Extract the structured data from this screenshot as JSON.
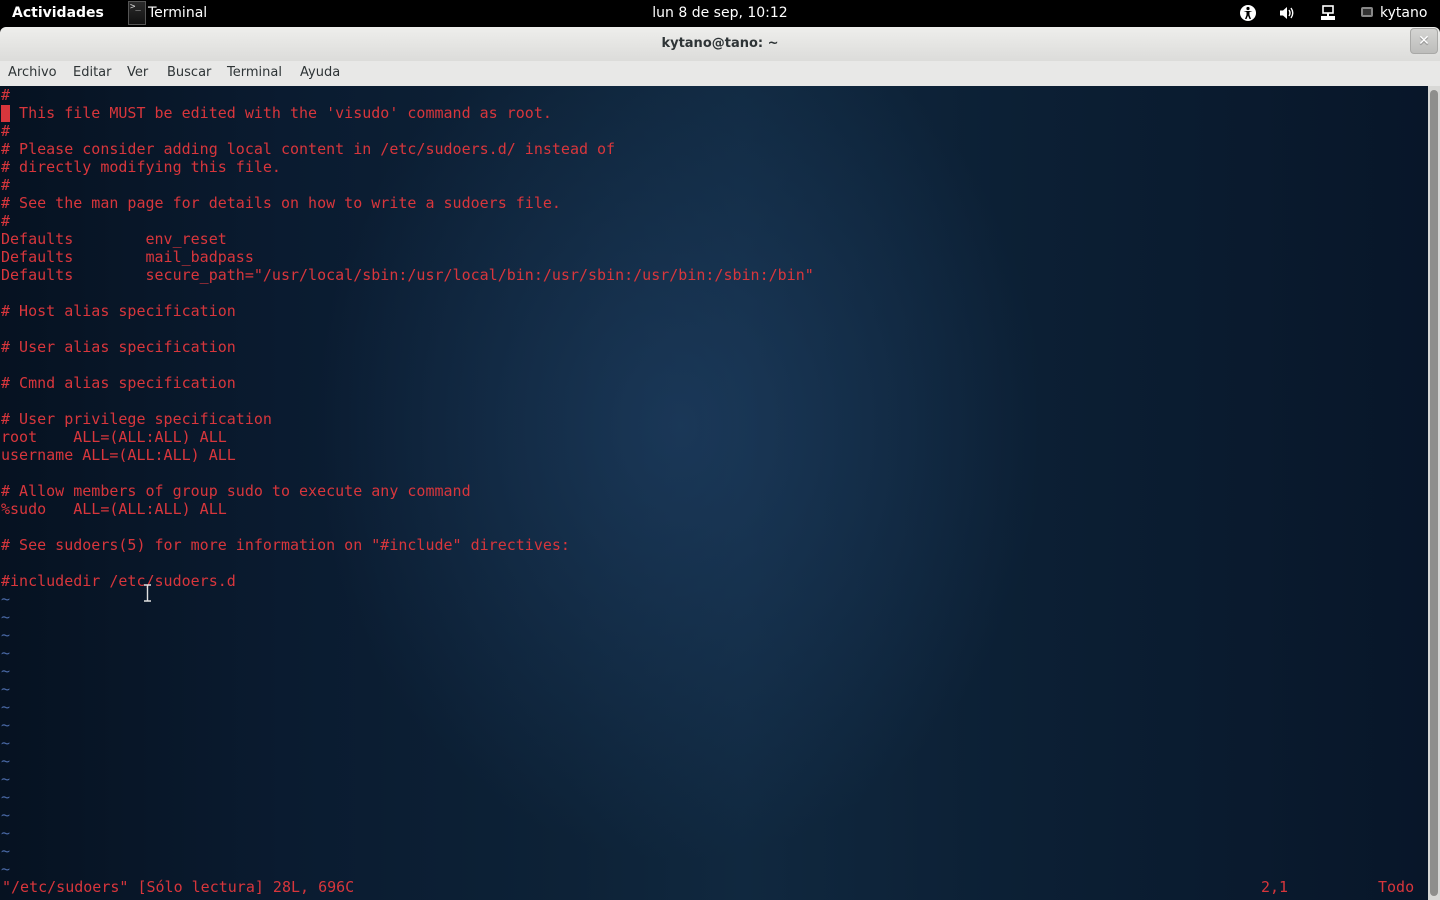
{
  "topbar": {
    "activities": "Actividades",
    "app_name": "Terminal",
    "clock": "lun  8 de sep, 10:12",
    "user": "kytano"
  },
  "window": {
    "title": "kytano@tano: ~",
    "close_symbol": "✕"
  },
  "menu": [
    "Archivo",
    "Editar",
    "Ver",
    "Buscar",
    "Terminal",
    "Ayuda"
  ],
  "editor": {
    "lines": [
      "#",
      "# This file MUST be edited with the 'visudo' command as root.",
      "#",
      "# Please consider adding local content in /etc/sudoers.d/ instead of",
      "# directly modifying this file.",
      "#",
      "# See the man page for details on how to write a sudoers file.",
      "#",
      "Defaults        env_reset",
      "Defaults        mail_badpass",
      "Defaults        secure_path=\"/usr/local/sbin:/usr/local/bin:/usr/sbin:/usr/bin:/sbin:/bin\"",
      "",
      "# Host alias specification",
      "",
      "# User alias specification",
      "",
      "# Cmnd alias specification",
      "",
      "# User privilege specification",
      "root    ALL=(ALL:ALL) ALL",
      "username ALL=(ALL:ALL) ALL",
      "",
      "# Allow members of group sudo to execute any command",
      "%sudo   ALL=(ALL:ALL) ALL",
      "",
      "# See sudoers(5) for more information on \"#include\" directives:",
      "",
      "#includedir /etc/sudoers.d"
    ],
    "empty_line_marker": "~",
    "empty_line_count": 16,
    "status_file": "\"/etc/sudoers\" [Sólo lectura] 28L, 696C",
    "status_position": "2,1",
    "status_percent": "Todo"
  },
  "colors": {
    "text": "#d8363c",
    "tilde": "#4a6aa8",
    "background": "#0d2237"
  },
  "icons": [
    "terminal-app-icon",
    "accessibility-icon",
    "volume-icon",
    "network-icon",
    "user-status-icon",
    "close-icon",
    "text-cursor-icon"
  ]
}
